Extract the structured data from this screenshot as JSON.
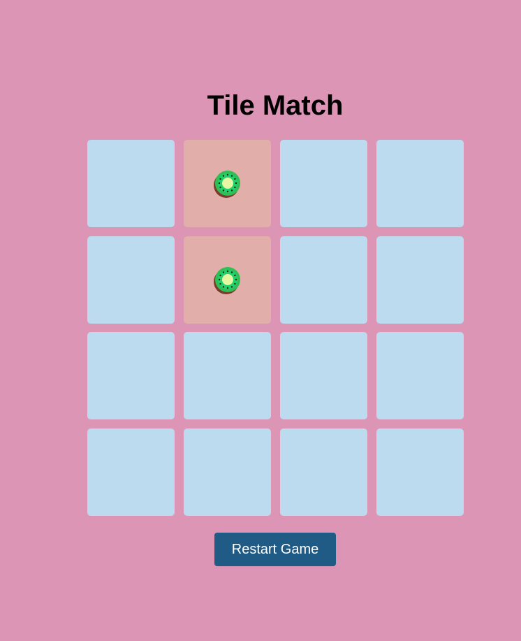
{
  "game": {
    "title": "Tile Match",
    "restart_label": "Restart Game"
  },
  "board": {
    "rows": 4,
    "columns": 4,
    "tiles": [
      {
        "state": "hidden"
      },
      {
        "state": "revealed",
        "icon": "kiwi-icon"
      },
      {
        "state": "hidden"
      },
      {
        "state": "hidden"
      },
      {
        "state": "hidden"
      },
      {
        "state": "revealed",
        "icon": "kiwi-icon"
      },
      {
        "state": "hidden"
      },
      {
        "state": "hidden"
      },
      {
        "state": "hidden"
      },
      {
        "state": "hidden"
      },
      {
        "state": "hidden"
      },
      {
        "state": "hidden"
      },
      {
        "state": "hidden"
      },
      {
        "state": "hidden"
      },
      {
        "state": "hidden"
      },
      {
        "state": "hidden"
      }
    ]
  },
  "colors": {
    "background": "#dd95b5",
    "tile_hidden": "#bddbee",
    "tile_revealed": "#e1aea9",
    "button": "#1f5b85"
  }
}
